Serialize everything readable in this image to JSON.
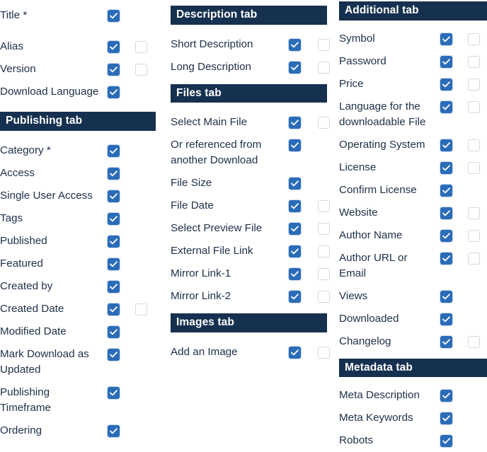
{
  "theme": {
    "header_bar_color": "#16304f",
    "header_text_color": "#ffffff",
    "checkbox_checked_color": "#2a6cb8",
    "checkbox_unchecked_border_color": "#d3d9e0",
    "label_text_color": "#20314a",
    "page_background": "#ffffff"
  },
  "columns": [
    {
      "id": "column-left",
      "blocks": [
        {
          "type": "rows",
          "rows": [
            {
              "label": "Title *",
              "primary": "checked",
              "secondary": "none"
            }
          ]
        },
        {
          "type": "rows",
          "rows": [
            {
              "label": "Alias",
              "primary": "checked",
              "secondary": "unchecked"
            },
            {
              "label": "Version",
              "primary": "checked",
              "secondary": "unchecked"
            },
            {
              "label": "Download Language",
              "primary": "checked",
              "secondary": "none"
            }
          ]
        },
        {
          "type": "header",
          "title": "Publishing tab"
        },
        {
          "type": "rows",
          "rows": [
            {
              "label": "Category *",
              "primary": "checked",
              "secondary": "none"
            },
            {
              "label": "Access",
              "primary": "checked",
              "secondary": "none"
            },
            {
              "label": "Single User Access",
              "primary": "checked",
              "secondary": "none"
            },
            {
              "label": "Tags",
              "primary": "checked",
              "secondary": "none"
            },
            {
              "label": "Published",
              "primary": "checked",
              "secondary": "none"
            },
            {
              "label": "Featured",
              "primary": "checked",
              "secondary": "none"
            },
            {
              "label": "Created by",
              "primary": "checked",
              "secondary": "none"
            },
            {
              "label": "Created Date",
              "primary": "checked",
              "secondary": "unchecked"
            },
            {
              "label": "Modified Date",
              "primary": "checked",
              "secondary": "none"
            },
            {
              "label": "Mark Download as Updated",
              "primary": "checked",
              "secondary": "none"
            },
            {
              "label": "Publishing Timeframe",
              "primary": "checked",
              "secondary": "none"
            },
            {
              "label": "Ordering",
              "primary": "checked",
              "secondary": "none"
            }
          ]
        }
      ]
    },
    {
      "id": "column-middle",
      "blocks": [
        {
          "type": "header",
          "title": "Description tab"
        },
        {
          "type": "rows",
          "rows": [
            {
              "label": "Short Description",
              "primary": "checked",
              "secondary": "unchecked"
            },
            {
              "label": "Long Description",
              "primary": "checked",
              "secondary": "unchecked"
            }
          ]
        },
        {
          "type": "header",
          "title": "Files tab"
        },
        {
          "type": "rows",
          "rows": [
            {
              "label": "Select Main File",
              "primary": "checked",
              "secondary": "unchecked"
            },
            {
              "label": "Or referenced from another Download",
              "primary": "checked",
              "secondary": "none"
            },
            {
              "label": "File Size",
              "primary": "checked",
              "secondary": "none"
            },
            {
              "label": "File Date",
              "primary": "checked",
              "secondary": "unchecked"
            },
            {
              "label": "Select Preview File",
              "primary": "checked",
              "secondary": "unchecked"
            },
            {
              "label": "External File Link",
              "primary": "checked",
              "secondary": "unchecked"
            },
            {
              "label": "Mirror Link-1",
              "primary": "checked",
              "secondary": "unchecked"
            },
            {
              "label": "Mirror Link-2",
              "primary": "checked",
              "secondary": "unchecked"
            }
          ]
        },
        {
          "type": "header",
          "title": "Images tab"
        },
        {
          "type": "rows",
          "rows": [
            {
              "label": "Add an Image",
              "primary": "checked",
              "secondary": "unchecked"
            }
          ]
        }
      ]
    },
    {
      "id": "column-right",
      "blocks": [
        {
          "type": "header",
          "title": "Additional tab"
        },
        {
          "type": "rows",
          "rows": [
            {
              "label": "Symbol",
              "primary": "checked",
              "secondary": "unchecked"
            },
            {
              "label": "Password",
              "primary": "checked",
              "secondary": "unchecked"
            },
            {
              "label": "Price",
              "primary": "checked",
              "secondary": "unchecked"
            },
            {
              "label": "Language for the downloadable File",
              "primary": "checked",
              "secondary": "unchecked"
            },
            {
              "label": "Operating System",
              "primary": "checked",
              "secondary": "unchecked"
            },
            {
              "label": "License",
              "primary": "checked",
              "secondary": "unchecked"
            },
            {
              "label": "Confirm License",
              "primary": "checked",
              "secondary": "none"
            },
            {
              "label": "Website",
              "primary": "checked",
              "secondary": "unchecked"
            },
            {
              "label": "Author Name",
              "primary": "checked",
              "secondary": "unchecked"
            },
            {
              "label": "Author URL or Email",
              "primary": "checked",
              "secondary": "unchecked"
            },
            {
              "label": "Views",
              "primary": "checked",
              "secondary": "none"
            },
            {
              "label": "Downloaded",
              "primary": "checked",
              "secondary": "none"
            },
            {
              "label": "Changelog",
              "primary": "checked",
              "secondary": "unchecked"
            }
          ]
        },
        {
          "type": "header",
          "title": "Metadata tab"
        },
        {
          "type": "rows",
          "rows": [
            {
              "label": "Meta Description",
              "primary": "checked",
              "secondary": "none"
            },
            {
              "label": "Meta Keywords",
              "primary": "checked",
              "secondary": "none"
            },
            {
              "label": "Robots",
              "primary": "checked",
              "secondary": "none"
            }
          ]
        }
      ]
    }
  ]
}
